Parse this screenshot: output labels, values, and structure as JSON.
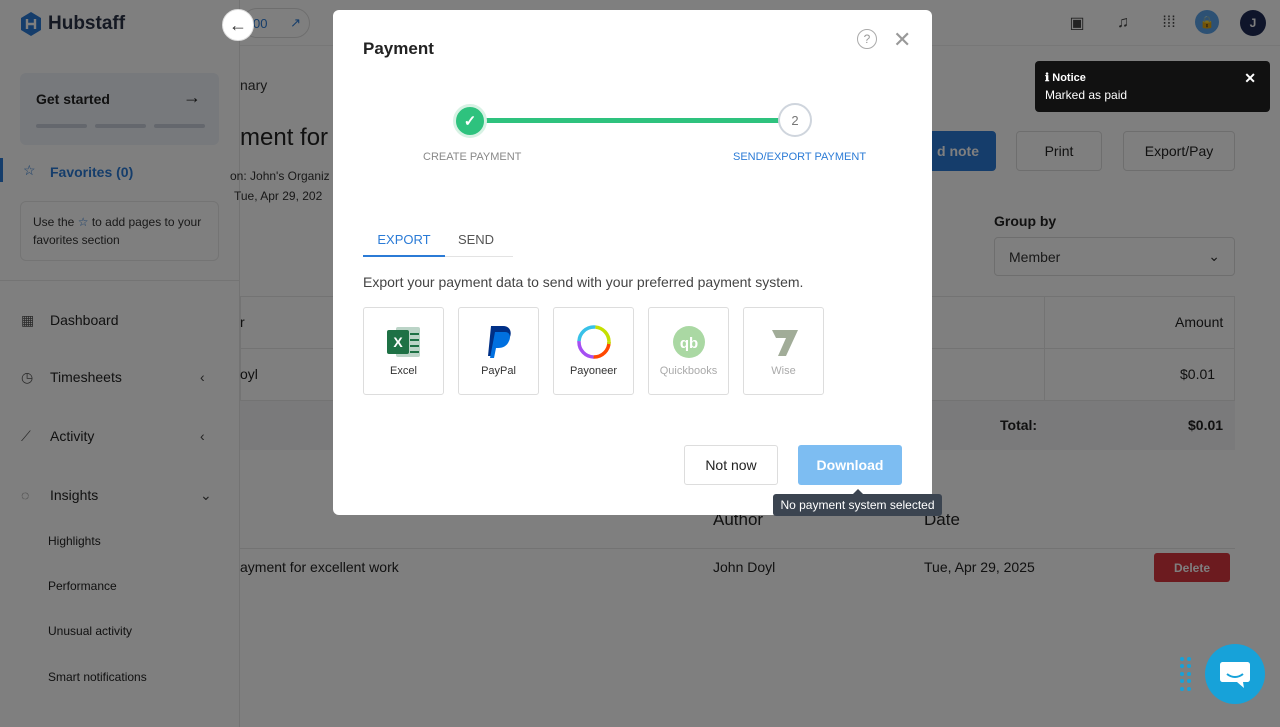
{
  "app": {
    "name": "Hubstaff"
  },
  "sidebar": {
    "get_started": "Get started",
    "favorites": "Favorites (0)",
    "favorites_hint_pre": "Use the",
    "favorites_hint_post": "to add pages to your favorites section",
    "nav": [
      {
        "label": "Dashboard",
        "icon": "dashboard-icon"
      },
      {
        "label": "Timesheets",
        "icon": "clock-icon"
      },
      {
        "label": "Activity",
        "icon": "activity-icon"
      },
      {
        "label": "Insights",
        "icon": "lightbulb-icon"
      }
    ],
    "insights_sub": [
      "Highlights",
      "Performance",
      "Unusual activity",
      "Smart notifications"
    ]
  },
  "topbar": {
    "date_fragment": "00",
    "avatar_initial": "J"
  },
  "page": {
    "breadcrumb": "nary",
    "title": "ment for T",
    "meta_org": "on:  John's Organiz",
    "meta_date": "Tue, Apr 29, 202",
    "add_note_label": "d note",
    "print_label": "Print",
    "export_label": "Export/Pay",
    "group_by_label": "Group by",
    "group_by_value": "Member",
    "table": {
      "col_member": "r",
      "col_amount": "Amount",
      "row_member": "oyl",
      "row_amount": "$0.01",
      "total_label": "Total:",
      "total_amount": "$0.01"
    },
    "notes": {
      "col_author": "Author",
      "col_date": "Date",
      "row_text": "ayment for excellent work",
      "row_author": "John Doyl",
      "row_date": "Tue, Apr 29, 2025",
      "delete_label": "Delete"
    }
  },
  "toast": {
    "heading": "Notice",
    "message": "Marked as paid"
  },
  "modal": {
    "title": "Payment",
    "step1_label": "CREATE PAYMENT",
    "step2_number": "2",
    "step2_label": "SEND/EXPORT PAYMENT",
    "tab_export": "EXPORT",
    "tab_send": "SEND",
    "description": "Export your payment data to send with your preferred payment system.",
    "options": [
      {
        "name": "Excel",
        "icon": "excel-icon",
        "enabled": true
      },
      {
        "name": "PayPal",
        "icon": "paypal-icon",
        "enabled": true
      },
      {
        "name": "Payoneer",
        "icon": "payoneer-icon",
        "enabled": true
      },
      {
        "name": "Quickbooks",
        "icon": "quickbooks-icon",
        "enabled": false
      },
      {
        "name": "Wise",
        "icon": "wise-icon",
        "enabled": false
      }
    ],
    "not_now": "Not now",
    "download": "Download",
    "tooltip": "No payment system selected"
  },
  "colors": {
    "accent": "#2b7bd6",
    "success": "#2ec27e",
    "danger": "#d9363e",
    "download_disabled": "#7dbdf2"
  }
}
